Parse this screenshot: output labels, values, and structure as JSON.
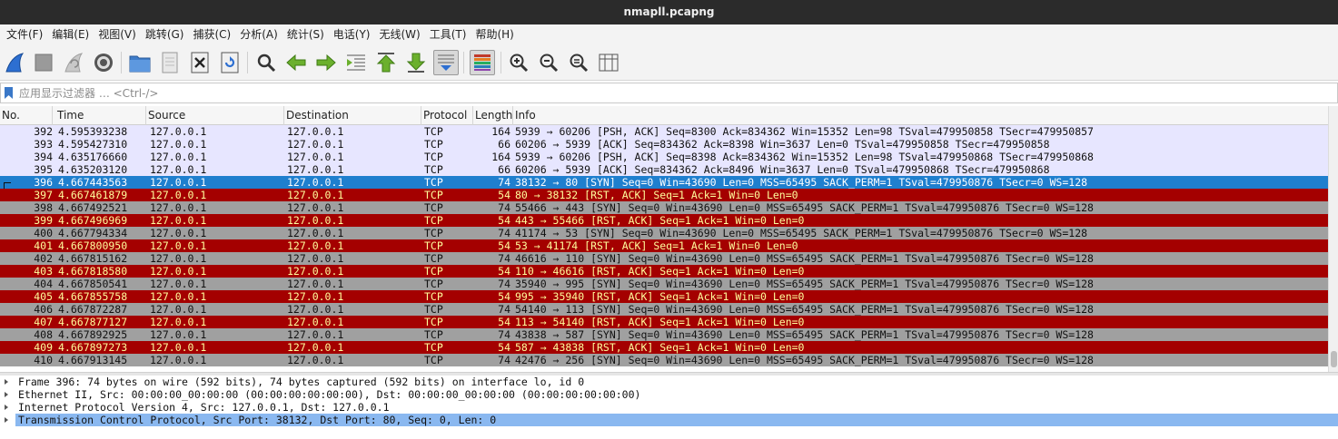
{
  "window": {
    "title": "nmapll.pcapng"
  },
  "menu": [
    "文件(F)",
    "编辑(E)",
    "视图(V)",
    "跳转(G)",
    "捕获(C)",
    "分析(A)",
    "统计(S)",
    "电话(Y)",
    "无线(W)",
    "工具(T)",
    "帮助(H)"
  ],
  "toolbar": {
    "icons": [
      "shark-fin-start-icon",
      "stop-capture-icon",
      "restart-capture-icon",
      "capture-options-gear-icon",
      "open-folder-icon",
      "file-icon",
      "close-file-icon",
      "reload-icon",
      "find-magnifier-icon",
      "go-back-arrow-icon",
      "go-forward-arrow-icon",
      "go-to-packet-icon",
      "go-first-packet-icon",
      "go-last-packet-icon",
      "autoscroll-icon",
      "colorize-icon",
      "zoom-in-icon",
      "zoom-out-icon",
      "zoom-normal-icon",
      "resize-columns-icon"
    ]
  },
  "filter": {
    "placeholder": "应用显示过滤器 … <Ctrl-/>",
    "value": ""
  },
  "columns": {
    "no": "No.",
    "time": "Time",
    "source": "Source",
    "destination": "Destination",
    "protocol": "Protocol",
    "length": "Length",
    "info": "Info"
  },
  "colors": {
    "tcp_row_bg": "#e7e6ff",
    "selected_row_bg": "#1f7fce",
    "rst_row_bg": "#a40000",
    "rst_row_fg": "#fffc9c",
    "syn_row_bg": "#a0a0a0",
    "detail_selected_bg": "#8ab8f0"
  },
  "packets": [
    {
      "no": "392",
      "time": "4.595393238",
      "src": "127.0.0.1",
      "dst": "127.0.0.1",
      "proto": "TCP",
      "len": "164",
      "info": "5939 → 60206 [PSH, ACK] Seq=8300 Ack=834362 Win=15352 Len=98 TSval=479950858 TSecr=479950857",
      "style": "tcp"
    },
    {
      "no": "393",
      "time": "4.595427310",
      "src": "127.0.0.1",
      "dst": "127.0.0.1",
      "proto": "TCP",
      "len": "66",
      "info": "60206 → 5939 [ACK] Seq=834362 Ack=8398 Win=3637 Len=0 TSval=479950858 TSecr=479950858",
      "style": "tcp"
    },
    {
      "no": "394",
      "time": "4.635176660",
      "src": "127.0.0.1",
      "dst": "127.0.0.1",
      "proto": "TCP",
      "len": "164",
      "info": "5939 → 60206 [PSH, ACK] Seq=8398 Ack=834362 Win=15352 Len=98 TSval=479950868 TSecr=479950868",
      "style": "tcp"
    },
    {
      "no": "395",
      "time": "4.635203120",
      "src": "127.0.0.1",
      "dst": "127.0.0.1",
      "proto": "TCP",
      "len": "66",
      "info": "60206 → 5939 [ACK] Seq=834362 Ack=8496 Win=3637 Len=0 TSval=479950868 TSecr=479950868",
      "style": "tcp"
    },
    {
      "no": "396",
      "time": "4.667443563",
      "src": "127.0.0.1",
      "dst": "127.0.0.1",
      "proto": "TCP",
      "len": "74",
      "info": "38132 → 80 [SYN] Seq=0 Win=43690 Len=0 MSS=65495 SACK_PERM=1 TSval=479950876 TSecr=0 WS=128",
      "style": "selected"
    },
    {
      "no": "397",
      "time": "4.667461879",
      "src": "127.0.0.1",
      "dst": "127.0.0.1",
      "proto": "TCP",
      "len": "54",
      "info": "80 → 38132 [RST, ACK] Seq=1 Ack=1 Win=0 Len=0",
      "style": "rst"
    },
    {
      "no": "398",
      "time": "4.667492521",
      "src": "127.0.0.1",
      "dst": "127.0.0.1",
      "proto": "TCP",
      "len": "74",
      "info": "55466 → 443 [SYN] Seq=0 Win=43690 Len=0 MSS=65495 SACK_PERM=1 TSval=479950876 TSecr=0 WS=128",
      "style": "syn"
    },
    {
      "no": "399",
      "time": "4.667496969",
      "src": "127.0.0.1",
      "dst": "127.0.0.1",
      "proto": "TCP",
      "len": "54",
      "info": "443 → 55466 [RST, ACK] Seq=1 Ack=1 Win=0 Len=0",
      "style": "rst"
    },
    {
      "no": "400",
      "time": "4.667794334",
      "src": "127.0.0.1",
      "dst": "127.0.0.1",
      "proto": "TCP",
      "len": "74",
      "info": "41174 → 53 [SYN] Seq=0 Win=43690 Len=0 MSS=65495 SACK_PERM=1 TSval=479950876 TSecr=0 WS=128",
      "style": "syn"
    },
    {
      "no": "401",
      "time": "4.667800950",
      "src": "127.0.0.1",
      "dst": "127.0.0.1",
      "proto": "TCP",
      "len": "54",
      "info": "53 → 41174 [RST, ACK] Seq=1 Ack=1 Win=0 Len=0",
      "style": "rst"
    },
    {
      "no": "402",
      "time": "4.667815162",
      "src": "127.0.0.1",
      "dst": "127.0.0.1",
      "proto": "TCP",
      "len": "74",
      "info": "46616 → 110 [SYN] Seq=0 Win=43690 Len=0 MSS=65495 SACK_PERM=1 TSval=479950876 TSecr=0 WS=128",
      "style": "syn"
    },
    {
      "no": "403",
      "time": "4.667818580",
      "src": "127.0.0.1",
      "dst": "127.0.0.1",
      "proto": "TCP",
      "len": "54",
      "info": "110 → 46616 [RST, ACK] Seq=1 Ack=1 Win=0 Len=0",
      "style": "rst"
    },
    {
      "no": "404",
      "time": "4.667850541",
      "src": "127.0.0.1",
      "dst": "127.0.0.1",
      "proto": "TCP",
      "len": "74",
      "info": "35940 → 995 [SYN] Seq=0 Win=43690 Len=0 MSS=65495 SACK_PERM=1 TSval=479950876 TSecr=0 WS=128",
      "style": "syn"
    },
    {
      "no": "405",
      "time": "4.667855758",
      "src": "127.0.0.1",
      "dst": "127.0.0.1",
      "proto": "TCP",
      "len": "54",
      "info": "995 → 35940 [RST, ACK] Seq=1 Ack=1 Win=0 Len=0",
      "style": "rst"
    },
    {
      "no": "406",
      "time": "4.667872287",
      "src": "127.0.0.1",
      "dst": "127.0.0.1",
      "proto": "TCP",
      "len": "74",
      "info": "54140 → 113 [SYN] Seq=0 Win=43690 Len=0 MSS=65495 SACK_PERM=1 TSval=479950876 TSecr=0 WS=128",
      "style": "syn"
    },
    {
      "no": "407",
      "time": "4.667877127",
      "src": "127.0.0.1",
      "dst": "127.0.0.1",
      "proto": "TCP",
      "len": "54",
      "info": "113 → 54140 [RST, ACK] Seq=1 Ack=1 Win=0 Len=0",
      "style": "rst"
    },
    {
      "no": "408",
      "time": "4.667892925",
      "src": "127.0.0.1",
      "dst": "127.0.0.1",
      "proto": "TCP",
      "len": "74",
      "info": "43838 → 587 [SYN] Seq=0 Win=43690 Len=0 MSS=65495 SACK_PERM=1 TSval=479950876 TSecr=0 WS=128",
      "style": "syn"
    },
    {
      "no": "409",
      "time": "4.667897273",
      "src": "127.0.0.1",
      "dst": "127.0.0.1",
      "proto": "TCP",
      "len": "54",
      "info": "587 → 43838 [RST, ACK] Seq=1 Ack=1 Win=0 Len=0",
      "style": "rst"
    },
    {
      "no": "410",
      "time": "4.667913145",
      "src": "127.0.0.1",
      "dst": "127.0.0.1",
      "proto": "TCP",
      "len": "74",
      "info": "42476 → 256 [SYN] Seq=0 Win=43690 Len=0 MSS=65495 SACK_PERM=1 TSval=479950876 TSecr=0 WS=128",
      "style": "syn"
    }
  ],
  "details": [
    {
      "text": "Frame 396: 74 bytes on wire (592 bits), 74 bytes captured (592 bits) on interface lo, id 0",
      "selected": false
    },
    {
      "text": "Ethernet II, Src: 00:00:00_00:00:00 (00:00:00:00:00:00), Dst: 00:00:00_00:00:00 (00:00:00:00:00:00)",
      "selected": false
    },
    {
      "text": "Internet Protocol Version 4, Src: 127.0.0.1, Dst: 127.0.0.1",
      "selected": false
    },
    {
      "text": "Transmission Control Protocol, Src Port: 38132, Dst Port: 80, Seq: 0, Len: 0",
      "selected": true
    }
  ]
}
